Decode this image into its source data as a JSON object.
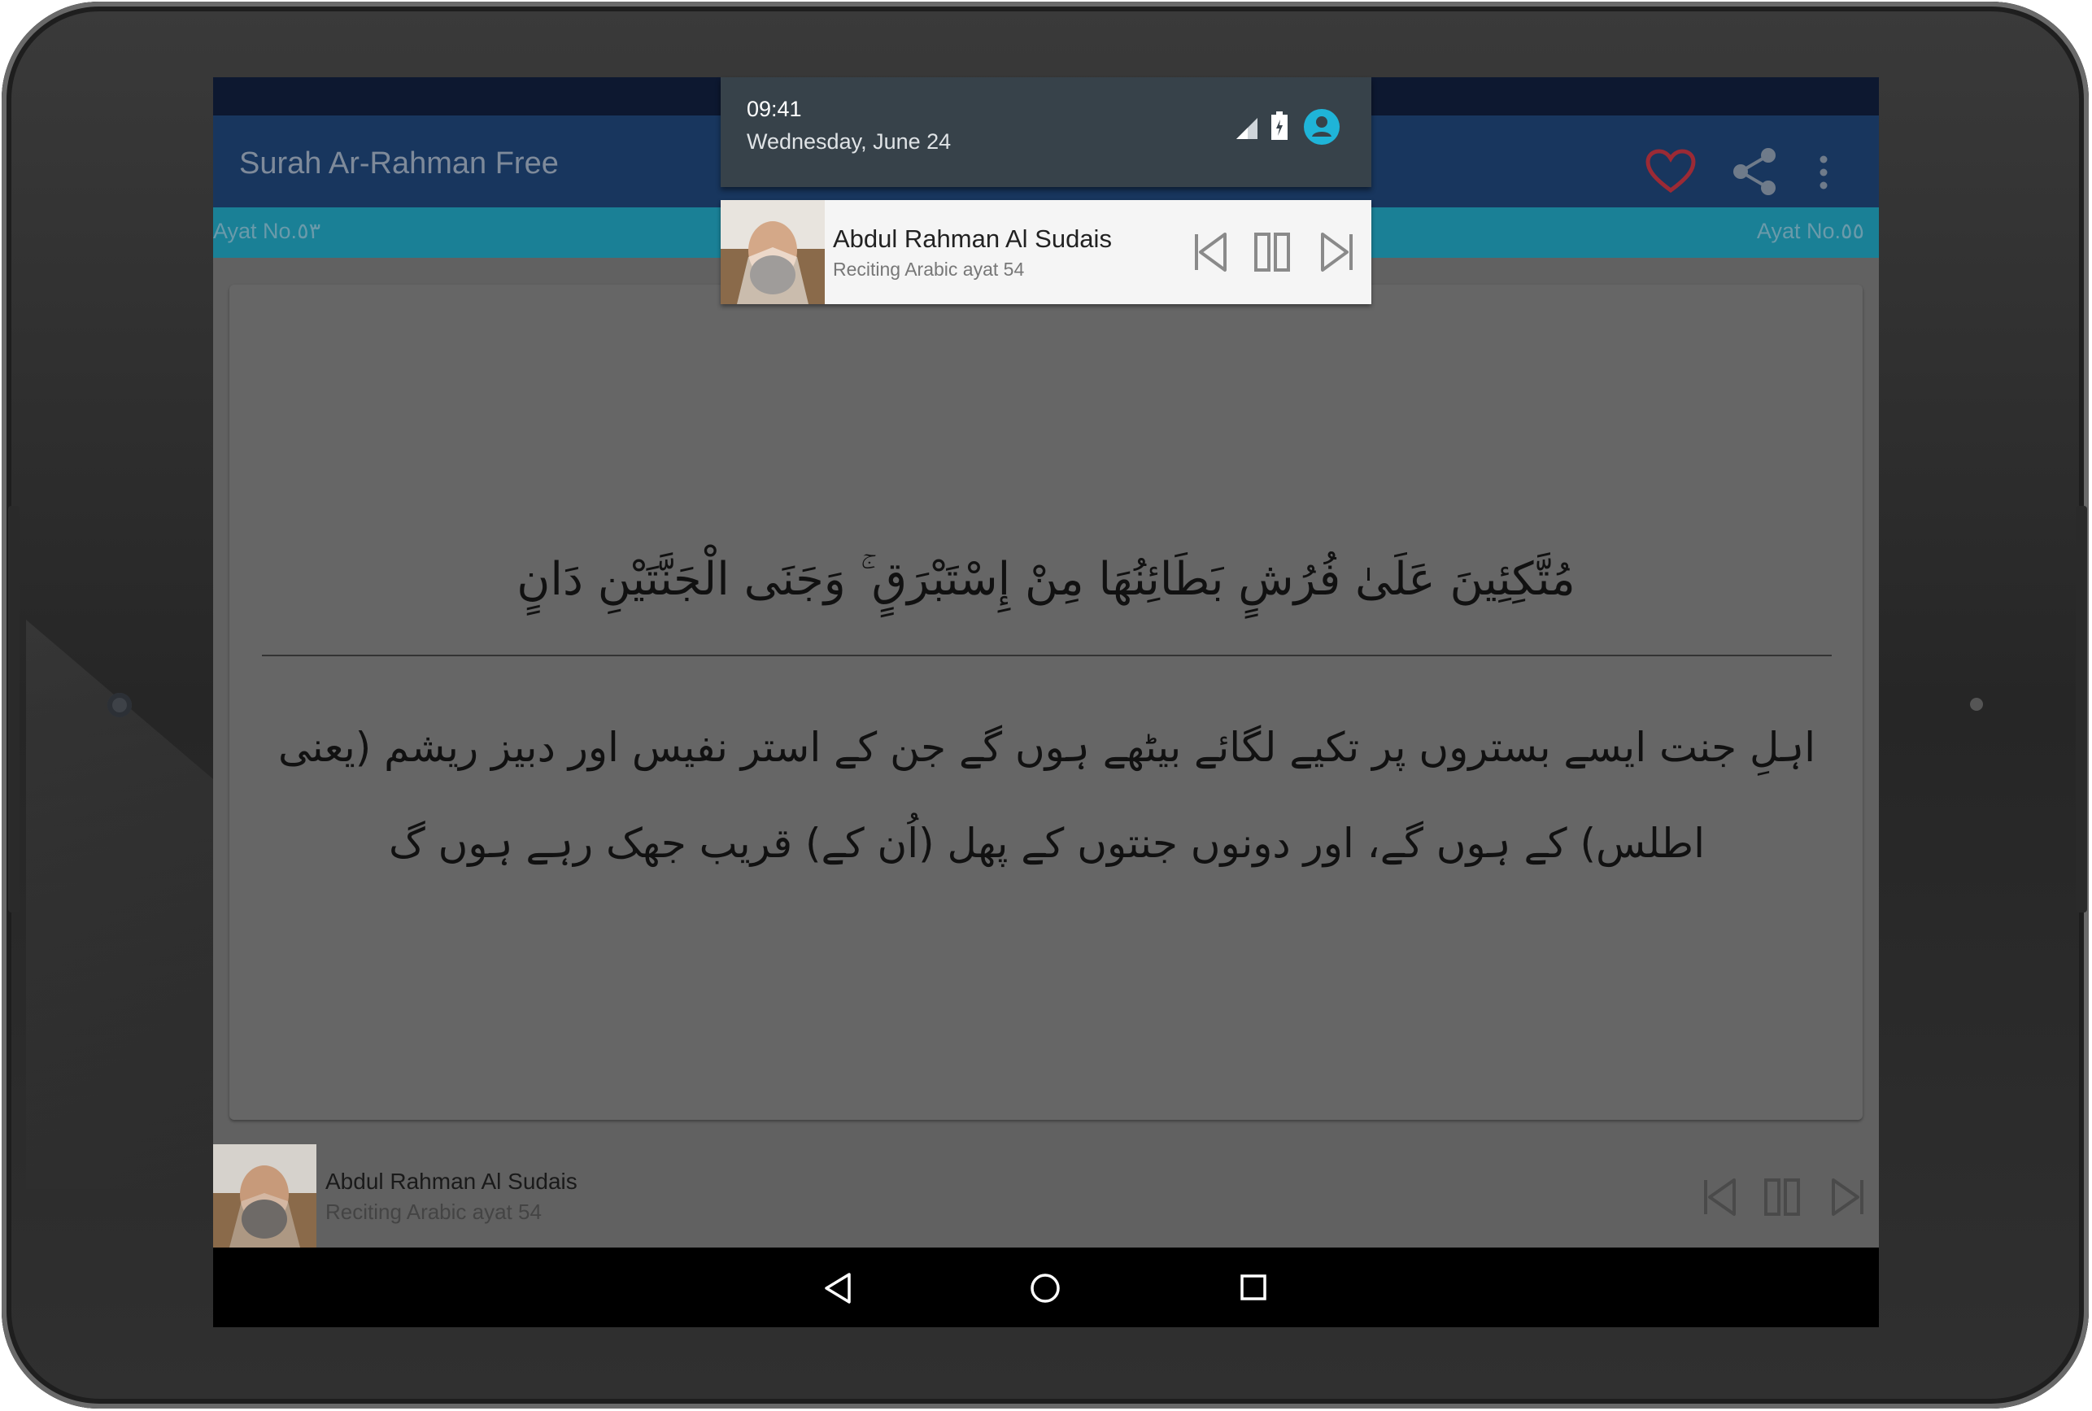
{
  "app": {
    "title": "Surah Ar-Rahman Free"
  },
  "ayat_bar": {
    "left": "Ayat No.٥٣",
    "right": "Ayat No.٥٥"
  },
  "verse": {
    "arabic": "مُتَّكِئِينَ عَلَىٰ فُرُشٍ بَطَائِنُهَا مِنْ إِسْتَبْرَقٍ ۚ وَجَنَى الْجَنَّتَيْنِ دَانٍ",
    "urdu": "اہلِ جنت ایسے بستروں پر تکیے لگائے بیٹھے ہوں گے جن کے استر نفیس اور دبیز ریشم (یعنی اطلس) کے ہوں گے، اور دونوں جنتوں کے پھل (اُن کے) قریب جھک رہے ہوں گ"
  },
  "player": {
    "name": "Abdul Rahman Al Sudais",
    "subtitle": "Reciting Arabic ayat 54"
  },
  "notification_shade": {
    "time": "09:41",
    "date": "Wednesday, June 24"
  },
  "notification": {
    "name": "Abdul Rahman Al Sudais",
    "subtitle": "Reciting Arabic ayat 54"
  },
  "icons": {
    "favorite": "heart-icon",
    "share": "share-icon",
    "overflow": "more-vert-icon",
    "previous": "skip-previous-icon",
    "pause": "pause-icon",
    "next": "skip-next-icon",
    "back": "nav-back-icon",
    "home": "nav-home-icon",
    "recents": "nav-recents-icon"
  },
  "colors": {
    "app_bar": "#18365e",
    "ayat_bar": "#1a8096",
    "favorite": "#9b2a35",
    "user_avatar": "#1fb4d8"
  }
}
